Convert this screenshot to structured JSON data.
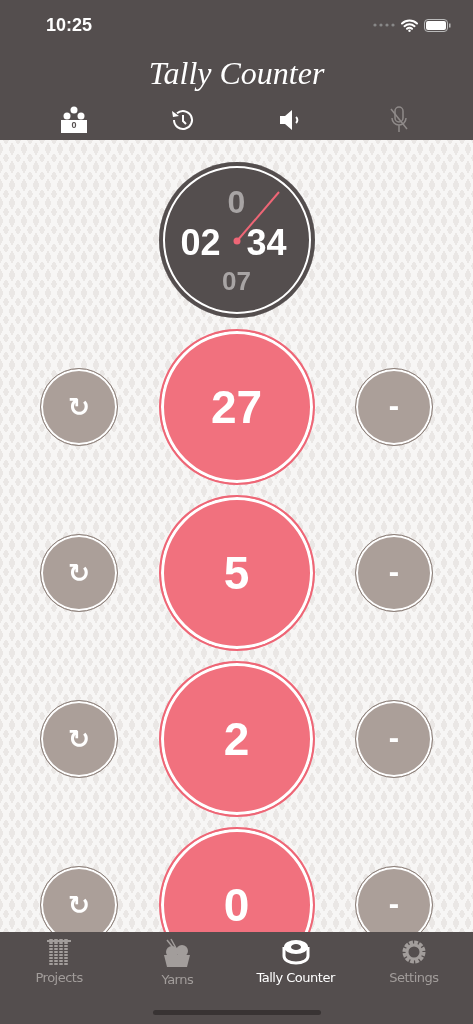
{
  "status_bar": {
    "time": "10:25"
  },
  "title": "Tally Counter",
  "toolbar": [
    {
      "kind": "team",
      "badge": "0"
    },
    {
      "kind": "history"
    },
    {
      "kind": "sound",
      "on": true
    },
    {
      "kind": "mic",
      "on": false
    }
  ],
  "timer": {
    "hours": "0",
    "minutes": "02",
    "seconds": "34",
    "fraction": "07"
  },
  "counters": [
    {
      "value": "27",
      "reset": "↻",
      "minus": "-"
    },
    {
      "value": "5",
      "reset": "↻",
      "minus": "-"
    },
    {
      "value": "2",
      "reset": "↻",
      "minus": "-"
    },
    {
      "value": "0",
      "reset": "↻",
      "minus": "-"
    }
  ],
  "tabs": [
    {
      "kind": "projects",
      "label": "Projects",
      "selected": false
    },
    {
      "kind": "yarns",
      "label": "Yarns",
      "selected": false
    },
    {
      "kind": "tally",
      "label": "Tally Counter",
      "selected": true
    },
    {
      "kind": "settings",
      "label": "Settings",
      "selected": false
    }
  ]
}
